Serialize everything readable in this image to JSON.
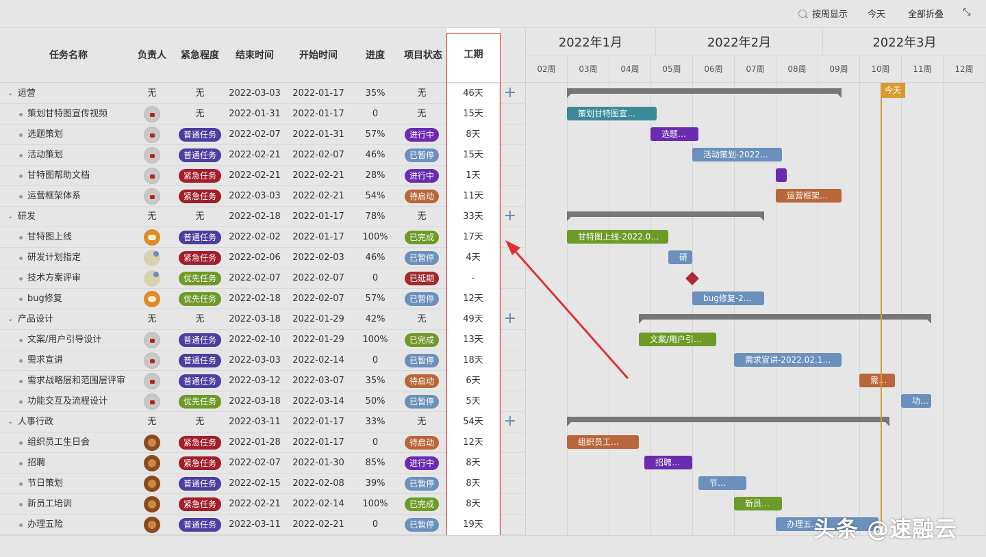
{
  "toolbar": {
    "week_view": "按周显示",
    "today": "今天",
    "collapse_all": "全部折叠"
  },
  "columns": {
    "name": "任务名称",
    "owner": "负责人",
    "urgency": "紧急程度",
    "end": "结束时间",
    "start": "开始时间",
    "progress": "进度",
    "status": "项目状态",
    "duration": "工期"
  },
  "rows": [
    {
      "level": "group",
      "name": "运营",
      "owner": "无",
      "urgency": "无",
      "end": "2022-03-03",
      "start": "2022-01-17",
      "progress": "35%",
      "status": "无",
      "duration": "46天"
    },
    {
      "level": "child",
      "name": "策划甘特图宣传视频",
      "avatar": "grey",
      "urgency": "无",
      "end": "2022-01-31",
      "start": "2022-01-17",
      "progress": "0",
      "status": "无",
      "duration": "15天"
    },
    {
      "level": "child",
      "name": "选题策划",
      "avatar": "grey",
      "urgency": "普通任务",
      "urgency_type": "normal",
      "end": "2022-02-07",
      "start": "2022-01-31",
      "progress": "57%",
      "status": "进行中",
      "status_type": "run",
      "duration": "8天"
    },
    {
      "level": "child",
      "name": "活动策划",
      "avatar": "grey",
      "urgency": "普通任务",
      "urgency_type": "normal",
      "end": "2022-02-21",
      "start": "2022-02-07",
      "progress": "46%",
      "status": "已暂停",
      "status_type": "pause",
      "duration": "15天"
    },
    {
      "level": "child",
      "name": "甘特图帮助文档",
      "avatar": "grey",
      "urgency": "紧急任务",
      "urgency_type": "urgent",
      "end": "2022-02-21",
      "start": "2022-02-21",
      "progress": "28%",
      "status": "进行中",
      "status_type": "run",
      "duration": "1天"
    },
    {
      "level": "child",
      "name": "运营框架体系",
      "avatar": "grey",
      "urgency": "紧急任务",
      "urgency_type": "urgent",
      "end": "2022-03-03",
      "start": "2022-02-21",
      "progress": "54%",
      "status": "待启动",
      "status_type": "wait",
      "duration": "11天"
    },
    {
      "level": "group",
      "name": "研发",
      "owner": "无",
      "urgency": "无",
      "end": "2022-02-18",
      "start": "2022-01-17",
      "progress": "78%",
      "status": "无",
      "duration": "33天"
    },
    {
      "level": "child",
      "name": "甘特图上线",
      "avatar": "tiger",
      "urgency": "普通任务",
      "urgency_type": "normal",
      "end": "2022-02-02",
      "start": "2022-01-17",
      "progress": "100%",
      "status": "已完成",
      "status_type": "done",
      "duration": "17天"
    },
    {
      "level": "child",
      "name": "研发计划指定",
      "avatar": "cat",
      "urgency": "紧急任务",
      "urgency_type": "urgent",
      "end": "2022-02-06",
      "start": "2022-02-03",
      "progress": "46%",
      "status": "已暂停",
      "status_type": "pause",
      "duration": "4天"
    },
    {
      "level": "child",
      "name": "技术方案评审",
      "avatar": "cat",
      "urgency": "优先任务",
      "urgency_type": "priority",
      "end": "2022-02-07",
      "start": "2022-02-07",
      "progress": "0",
      "status": "已延期",
      "status_type": "late",
      "duration": "-"
    },
    {
      "level": "child",
      "name": "bug修复",
      "avatar": "tiger",
      "urgency": "优先任务",
      "urgency_type": "priority",
      "end": "2022-02-18",
      "start": "2022-02-07",
      "progress": "57%",
      "status": "已暂停",
      "status_type": "pause",
      "duration": "12天"
    },
    {
      "level": "group",
      "name": "产品设计",
      "owner": "无",
      "urgency": "无",
      "end": "2022-03-18",
      "start": "2022-01-29",
      "progress": "42%",
      "status": "无",
      "duration": "49天"
    },
    {
      "level": "child",
      "name": "文案/用户引导设计",
      "avatar": "grey",
      "urgency": "普通任务",
      "urgency_type": "normal",
      "end": "2022-02-10",
      "start": "2022-01-29",
      "progress": "100%",
      "status": "已完成",
      "status_type": "done",
      "duration": "13天"
    },
    {
      "level": "child",
      "name": "需求宣讲",
      "avatar": "grey",
      "urgency": "普通任务",
      "urgency_type": "normal",
      "end": "2022-03-03",
      "start": "2022-02-14",
      "progress": "0",
      "status": "已暂停",
      "status_type": "pause",
      "duration": "18天"
    },
    {
      "level": "child",
      "name": "需求战略层和范围层评审",
      "avatar": "grey",
      "urgency": "普通任务",
      "urgency_type": "normal",
      "end": "2022-03-12",
      "start": "2022-03-07",
      "progress": "35%",
      "status": "待启动",
      "status_type": "wait",
      "duration": "6天"
    },
    {
      "level": "child",
      "name": "功能交互及流程设计",
      "avatar": "grey",
      "urgency": "优先任务",
      "urgency_type": "priority",
      "end": "2022-03-18",
      "start": "2022-03-14",
      "progress": "50%",
      "status": "已暂停",
      "status_type": "pause",
      "duration": "5天"
    },
    {
      "level": "group",
      "name": "人事行政",
      "owner": "无",
      "urgency": "无",
      "end": "2022-03-11",
      "start": "2022-01-17",
      "progress": "33%",
      "status": "无",
      "duration": "54天"
    },
    {
      "level": "child",
      "name": "组织员工生日会",
      "avatar": "lion",
      "urgency": "紧急任务",
      "urgency_type": "urgent",
      "end": "2022-01-28",
      "start": "2022-01-17",
      "progress": "0",
      "status": "待启动",
      "status_type": "wait",
      "duration": "12天"
    },
    {
      "level": "child",
      "name": "招聘",
      "avatar": "lion",
      "urgency": "紧急任务",
      "urgency_type": "urgent",
      "end": "2022-02-07",
      "start": "2022-01-30",
      "progress": "85%",
      "status": "进行中",
      "status_type": "run",
      "duration": "8天"
    },
    {
      "level": "child",
      "name": "节日策划",
      "avatar": "lion",
      "urgency": "普通任务",
      "urgency_type": "normal",
      "end": "2022-02-15",
      "start": "2022-02-08",
      "progress": "39%",
      "status": "已暂停",
      "status_type": "pause",
      "duration": "8天"
    },
    {
      "level": "child",
      "name": "新员工培训",
      "avatar": "lion",
      "urgency": "紧急任务",
      "urgency_type": "urgent",
      "end": "2022-02-21",
      "start": "2022-02-14",
      "progress": "100%",
      "status": "已完成",
      "status_type": "done",
      "duration": "8天"
    },
    {
      "level": "child",
      "name": "办理五险",
      "avatar": "lion",
      "urgency": "普通任务",
      "urgency_type": "normal",
      "end": "2022-03-11",
      "start": "2022-02-21",
      "progress": "0",
      "status": "已暂停",
      "status_type": "pause",
      "duration": "19天"
    }
  ],
  "gantt": {
    "months": [
      "2022年1月",
      "2022年2月",
      "2022年3月"
    ],
    "weeks": [
      "02周",
      "03周",
      "04周",
      "05周",
      "06周",
      "07周",
      "08周",
      "09周",
      "10周",
      "11周",
      "12周"
    ],
    "today_label": "今天",
    "bars": [
      {
        "row": 1,
        "label": "策划甘特图宣…",
        "color": "#3a8a9a"
      },
      {
        "row": 2,
        "label": "选题…",
        "color": "#6a2bb0"
      },
      {
        "row": 3,
        "label": "活动策划-2022…",
        "color": "#6b90bc"
      },
      {
        "row": 4,
        "label": "",
        "color": "#6a2bb0"
      },
      {
        "row": 5,
        "label": "运营框架…",
        "color": "#b8663a"
      },
      {
        "row": 7,
        "label": "甘特图上线-2022.0…",
        "color": "#6e9a28"
      },
      {
        "row": 8,
        "label": "研",
        "color": "#6b90bc"
      },
      {
        "row": 10,
        "label": "bug修复-2…",
        "color": "#6b90bc"
      },
      {
        "row": 12,
        "label": "文案/用户引…",
        "color": "#6e9a28"
      },
      {
        "row": 13,
        "label": "需求宣讲-2022.02.1…",
        "color": "#6b90bc"
      },
      {
        "row": 14,
        "label": "需…",
        "color": "#b8663a"
      },
      {
        "row": 15,
        "label": "功…",
        "color": "#6b90bc"
      },
      {
        "row": 17,
        "label": "组织员工…",
        "color": "#b8663a"
      },
      {
        "row": 18,
        "label": "招聘…",
        "color": "#6a2bb0"
      },
      {
        "row": 19,
        "label": "节…",
        "color": "#6b90bc"
      },
      {
        "row": 20,
        "label": "新员…",
        "color": "#6e9a28"
      },
      {
        "row": 21,
        "label": "办理五…",
        "color": "#6b90bc"
      }
    ]
  },
  "watermark": "头条 @速融云"
}
